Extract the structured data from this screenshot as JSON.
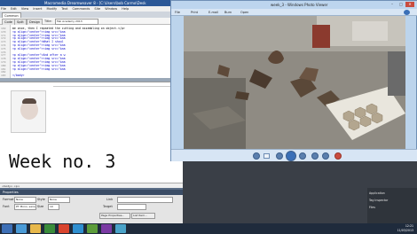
{
  "dreamweaver": {
    "title": "Macromedia Dreamweaver 8 - [C:\\Users\\bob Carmo\\Desk",
    "menu": [
      "File",
      "Edit",
      "View",
      "Insert",
      "Modify",
      "Text",
      "Commands",
      "Site",
      "Window",
      "Help"
    ],
    "tab_label": "Common",
    "toolbar": {
      "code": "Code",
      "split": "Split",
      "design": "Design",
      "title_label": "Title:",
      "title_value": "Fab Academy 2013"
    },
    "code_lines": [
      {
        "num": "169",
        "text": "me once, then I repeated the cutting and assembling on object.</p>"
      },
      {
        "num": "170",
        "text": "<p align=\"center\"><img src=\"ima"
      },
      {
        "num": "171",
        "text": "<p align=\"center\"><img src=\"ima"
      },
      {
        "num": "172",
        "text": "<p align=\"center\"><img src=\"ima"
      },
      {
        "num": "173",
        "text": "<p align=\"center\">What I shoul"
      },
      {
        "num": "174",
        "text": "<p align=\"center\"><img src=\"ima"
      },
      {
        "num": "175",
        "text": "<p align=\"center\"><img src=\"ima"
      },
      {
        "num": "176",
        "text": ""
      },
      {
        "num": "177",
        "text": "<p align=\"center\">And after a w"
      },
      {
        "num": "178",
        "text": "<p align=\"center\"><img src=\"ima"
      },
      {
        "num": "179",
        "text": "<p align=\"center\"><img src=\"ima"
      },
      {
        "num": "180",
        "text": "<p align=\"center\"><img src=\"ima"
      },
      {
        "num": "181",
        "text": "<p align=\"center\"><img src=\"ima"
      },
      {
        "num": "182",
        "text": ""
      },
      {
        "num": "183",
        "text": "</body>"
      }
    ],
    "week_heading": "Week no. 3",
    "status_text": "<body> <p>",
    "properties": {
      "header": "Properties",
      "format_label": "Format",
      "format_value": "None",
      "style_label": "Style",
      "style_value": "None",
      "font_label": "Font",
      "font_value": "PT Mono, sans-s",
      "size_label": "Size",
      "size_value": "10",
      "link_label": "Link",
      "target_label": "Target",
      "page_properties": "Page Properties...",
      "list_item": "List Item..."
    },
    "panels": [
      "Application",
      "Tag Inspector",
      "Files"
    ]
  },
  "photo_viewer": {
    "title": "week_3 - Windows Photo Viewer",
    "menu": [
      "File",
      "Print",
      "E-mail",
      "Burn",
      "Open"
    ],
    "window_buttons": {
      "minimize": "–",
      "maximize": "□",
      "close": "✕"
    }
  },
  "taskbar": {
    "time": "12:21",
    "date": "11/03/2013"
  },
  "colors": {
    "dw_title": "#2b5797",
    "pv_chrome": "#bdd5ee",
    "taskbar": "#1f2b3c"
  }
}
